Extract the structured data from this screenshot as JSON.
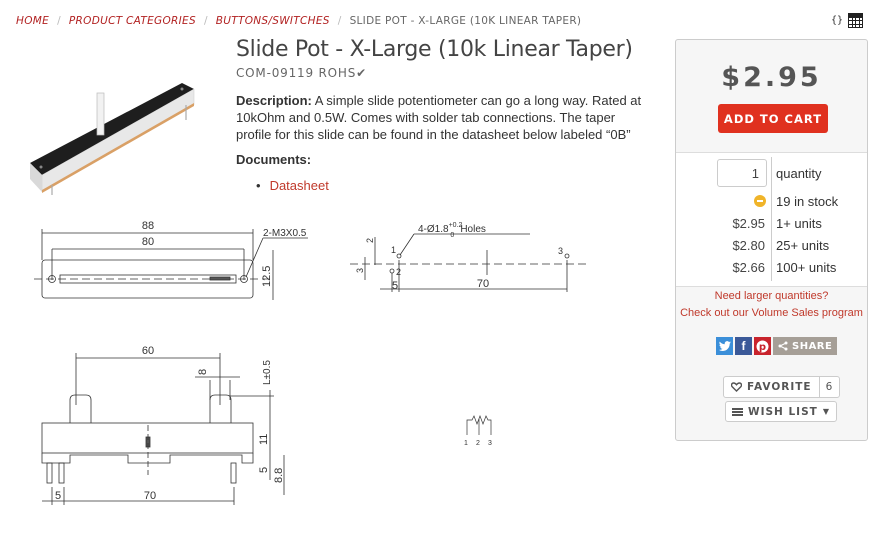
{
  "breadcrumb": {
    "items": [
      "HOME",
      "PRODUCT CATEGORIES",
      "BUTTONS/SWITCHES"
    ],
    "separator": "/",
    "current": "SLIDE POT - X-LARGE (10K LINEAR TAPER)"
  },
  "top_icons": {
    "braces": "{}",
    "grid": "grid-icon"
  },
  "product": {
    "title": "Slide Pot - X-Large (10k Linear Taper)",
    "sku": "COM-09119",
    "rohs": "ROHS",
    "rohs_check": "✔",
    "description_label": "Description:",
    "description": " A simple slide potentiometer can go a long way. Rated at 10kOhm and 0.5W. Comes with solder tab connections. The taper profile for this slide can be found in the datasheet below labeled “0B”",
    "documents_label": "Documents:",
    "documents": [
      {
        "label": "Datasheet"
      }
    ]
  },
  "drawing": {
    "dim_88": "88",
    "dim_80": "80",
    "thread": "2-M3X0.5",
    "dim_12_5": "12.5",
    "holes": "4-Ø1.8",
    "tol_plus": "+0.2",
    "tol_zero": "0",
    "holes_word": "Holes",
    "dim_2": "2",
    "dim_3": "3",
    "dim_5": "5",
    "dim_70": "70",
    "pin1": "1",
    "pin2": "2",
    "pin3": "3",
    "dim_60": "60",
    "dim_8": "8",
    "dim_L": "L±0.5",
    "dim_11": "11",
    "dim_8_8": "8.8"
  },
  "buy_box": {
    "price": "$2.95",
    "add_to_cart": "ADD TO CART",
    "quantity_value": "1",
    "quantity_label": "quantity",
    "stock": "19 in stock",
    "price_breaks": [
      {
        "price": "$2.95",
        "units": "1+ units"
      },
      {
        "price": "$2.80",
        "units": "25+ units"
      },
      {
        "price": "$2.66",
        "units": "100+ units"
      }
    ],
    "volume_line1": "Need larger quantities?",
    "volume_line2": "Check out our Volume Sales program",
    "share_label": "SHARE",
    "favorite_label": "FAVORITE",
    "favorite_count": "6",
    "wishlist_label": "WISH LIST"
  },
  "colors": {
    "accent": "#e0311f",
    "link": "#c0392b",
    "stock": "#f0b429"
  }
}
